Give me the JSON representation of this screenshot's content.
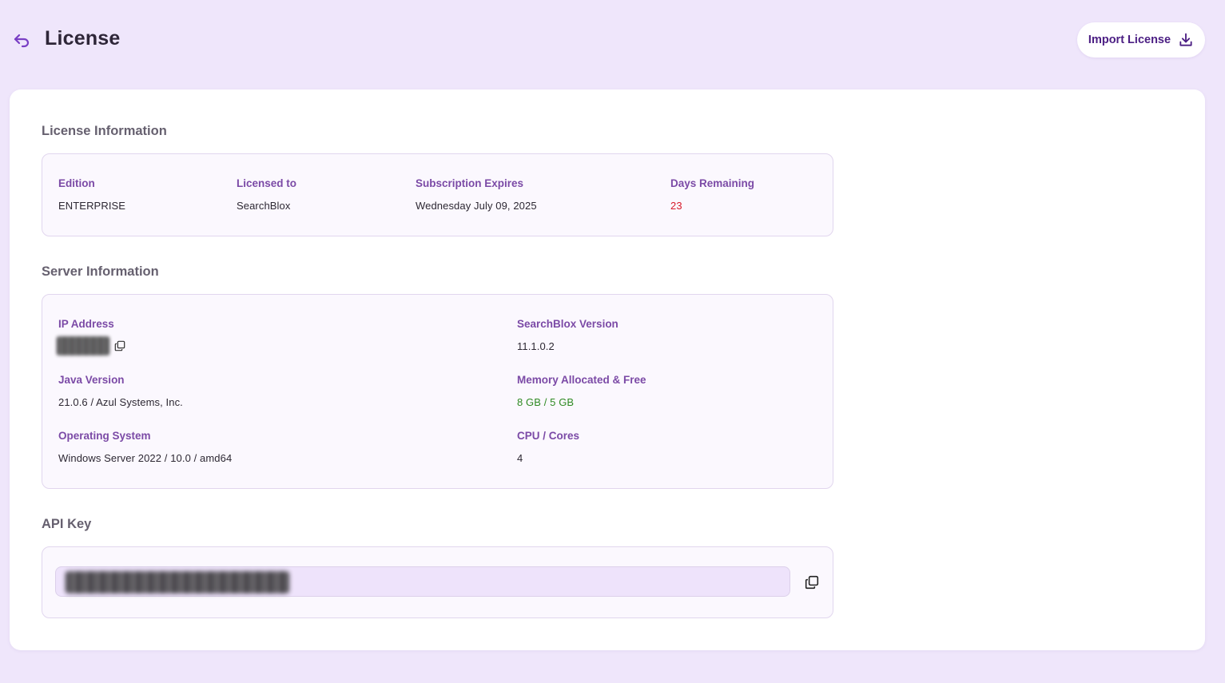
{
  "header": {
    "title": "License",
    "back_icon": "undo-arrow-icon",
    "import_button_label": "Import License",
    "import_icon": "download-icon"
  },
  "license_info": {
    "title": "License Information",
    "edition": {
      "label": "Edition",
      "value": "ENTERPRISE"
    },
    "licensed_to": {
      "label": "Licensed to",
      "value": "SearchBlox"
    },
    "subscription_expires": {
      "label": "Subscription Expires",
      "value": "Wednesday July 09, 2025"
    },
    "days_remaining": {
      "label": "Days Remaining",
      "value": "23"
    }
  },
  "server_info": {
    "title": "Server Information",
    "ip_address": {
      "label": "IP Address",
      "value": ""
    },
    "searchblox_version": {
      "label": "SearchBlox Version",
      "value": "11.1.0.2"
    },
    "java_version": {
      "label": "Java Version",
      "value": "21.0.6 / Azul Systems, Inc."
    },
    "memory": {
      "label": "Memory Allocated & Free",
      "value": "8 GB / 5 GB"
    },
    "operating_system": {
      "label": "Operating System",
      "value": "Windows Server 2022 / 10.0 / amd64"
    },
    "cpu": {
      "label": "CPU / Cores",
      "value": "4"
    }
  },
  "api_key": {
    "title": "API Key",
    "value": ""
  },
  "colors": {
    "accent": "#7b4aa6",
    "button_text": "#4b1e83",
    "days_remaining": "#d81a2a",
    "memory": "#2f8a23",
    "background": "#efe6fb"
  }
}
